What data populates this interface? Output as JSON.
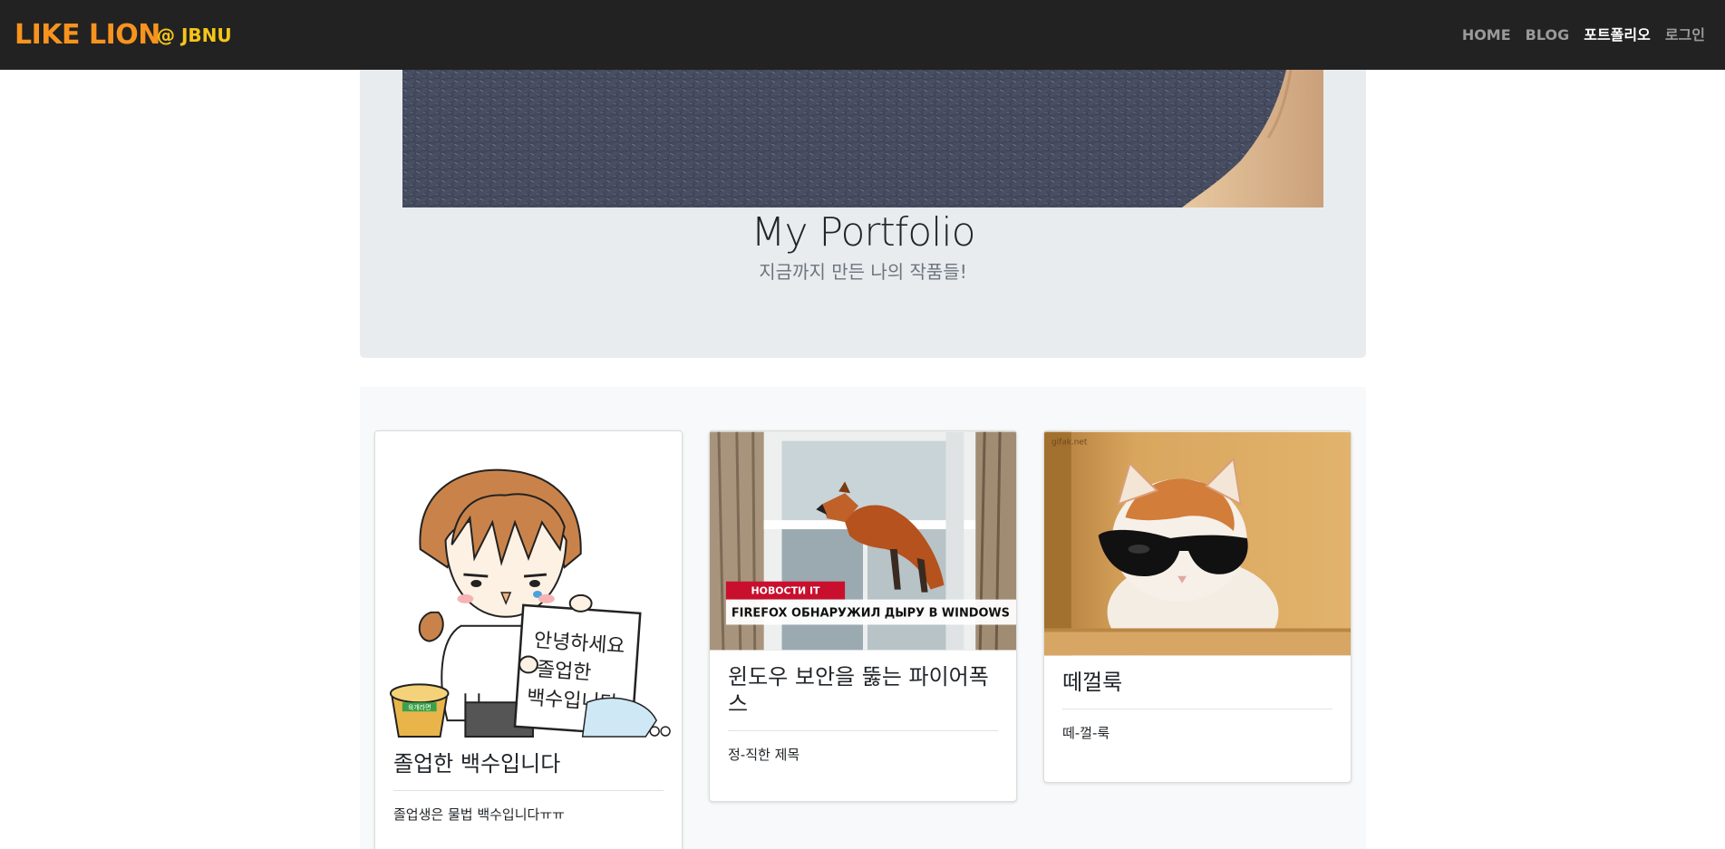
{
  "navbar": {
    "brand": "LIKE LION",
    "brand_sub": "@ JBNU",
    "links": [
      {
        "label": "HOME",
        "active": false
      },
      {
        "label": "BLOG",
        "active": false
      },
      {
        "label": "포트폴리오",
        "active": true
      },
      {
        "label": "로그인",
        "active": false
      }
    ]
  },
  "hero": {
    "title": "My Portfolio",
    "subtitle": "지금까지 만든 나의 작품들!"
  },
  "cards": [
    {
      "title": "졸업한 백수입니다",
      "text": "졸업생은 물법 백수입니다ㅠㅠ",
      "image_icon": "graduate-cartoon-image"
    },
    {
      "title": "윈도우 보안을 뚫는 파이어폭스",
      "text": "정-직한 제목",
      "image_icon": "firefox-fox-image",
      "image_caption_tag": "НОВОСТИ IT",
      "image_caption": "FIREFOX ОБНАРУЖИЛ ДЫРУ В WINDOWS"
    },
    {
      "title": "떼껄룩",
      "text": "떼-껄-룩",
      "image_icon": "sunglasses-cat-image",
      "image_watermark": "gifak.net"
    }
  ],
  "cartoon_sign": [
    "안녕하세요",
    "졸업한",
    "백수입니다."
  ],
  "cartoon_cup_label": "육개라면",
  "colors": {
    "navbar_bg": "#222222",
    "brand": "#f7931e",
    "brand_sub": "#f5c518",
    "jumbotron_bg": "#e9ecef",
    "album_bg": "#f8f9fa"
  }
}
